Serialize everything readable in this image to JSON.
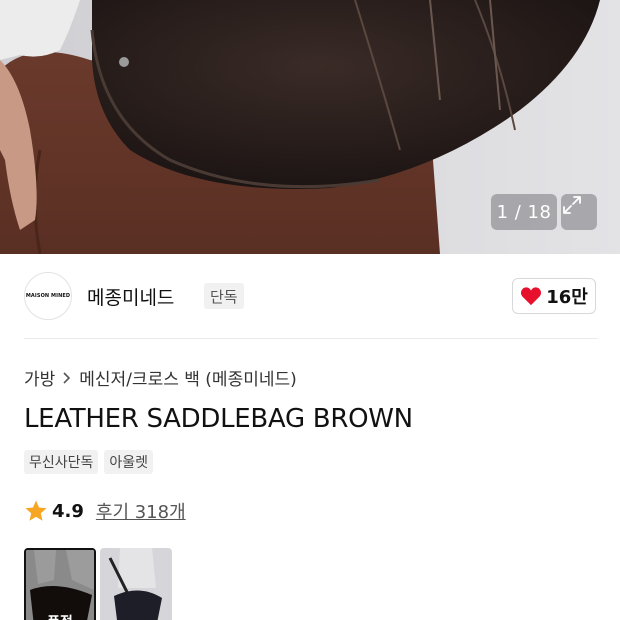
{
  "gallery": {
    "counter": "1 / 18",
    "expand_icon": "expand-arrows-icon"
  },
  "brand": {
    "logo_text": "MAISON MINED",
    "name": "메종미네드",
    "badge": "단독",
    "like_count": "16만",
    "heart_color": "#e8112d"
  },
  "breadcrumb": {
    "items": [
      "가방",
      "메신저/크로스 백 (메종미네드)"
    ]
  },
  "product": {
    "title": "LEATHER SADDLEBAG BROWN",
    "tags": [
      "무신사단독",
      "아울렛"
    ]
  },
  "rating": {
    "value": "4.9",
    "review_link": "후기 318개",
    "star_color": "#f6a623"
  },
  "thumbnails": {
    "items": [
      {
        "label": "품절",
        "selected": true
      },
      {
        "label": "",
        "selected": false
      }
    ]
  }
}
